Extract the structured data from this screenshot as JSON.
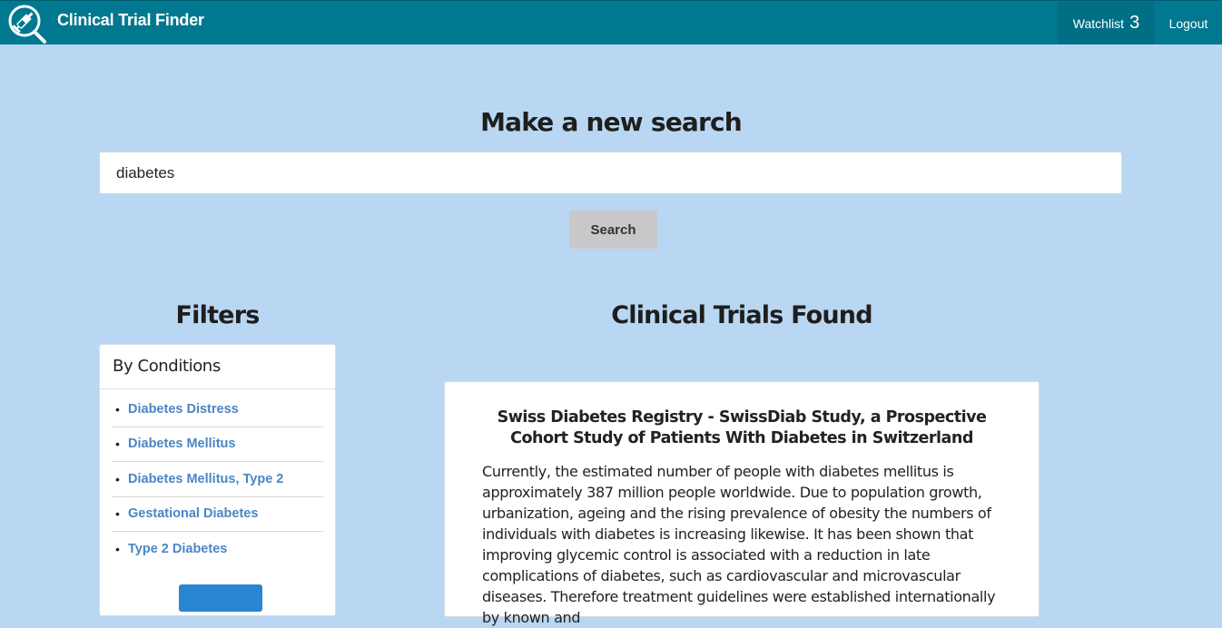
{
  "navbar": {
    "title": "Clinical Trial Finder",
    "logo_icon": "syringe-magnifier-icon",
    "watchlist_label": "Watchlist",
    "watchlist_count": "3",
    "logout_label": "Logout"
  },
  "search": {
    "heading": "Make a new search",
    "value": "diabetes",
    "button_label": "Search"
  },
  "filters": {
    "heading": "Filters",
    "card_title": "By Conditions",
    "items": [
      {
        "label": "Diabetes Distress"
      },
      {
        "label": "Diabetes Mellitus"
      },
      {
        "label": "Diabetes Mellitus, Type 2"
      },
      {
        "label": "Gestational Diabetes"
      },
      {
        "label": "Type 2 Diabetes"
      }
    ]
  },
  "results": {
    "heading": "Clinical Trials Found",
    "trials": [
      {
        "title": "Swiss Diabetes Registry - SwissDiab Study, a Prospective Cohort Study of Patients With Diabetes in Switzerland",
        "summary": "Currently, the estimated number of people with diabetes mellitus is approximately 387 million people worldwide. Due to population growth, urbanization, ageing and the rising prevalence of obesity the numbers of individuals with diabetes is increasing likewise. It has been shown that improving glycemic control is associated with a reduction in late complications of diabetes, such as cardiovascular and microvascular diseases. Therefore treatment guidelines were established internationally by known and"
      }
    ]
  },
  "colors": {
    "navbar": "#007890",
    "background": "#b9d7f2",
    "link": "#4a86c4",
    "apply_button": "#2a86d0"
  }
}
